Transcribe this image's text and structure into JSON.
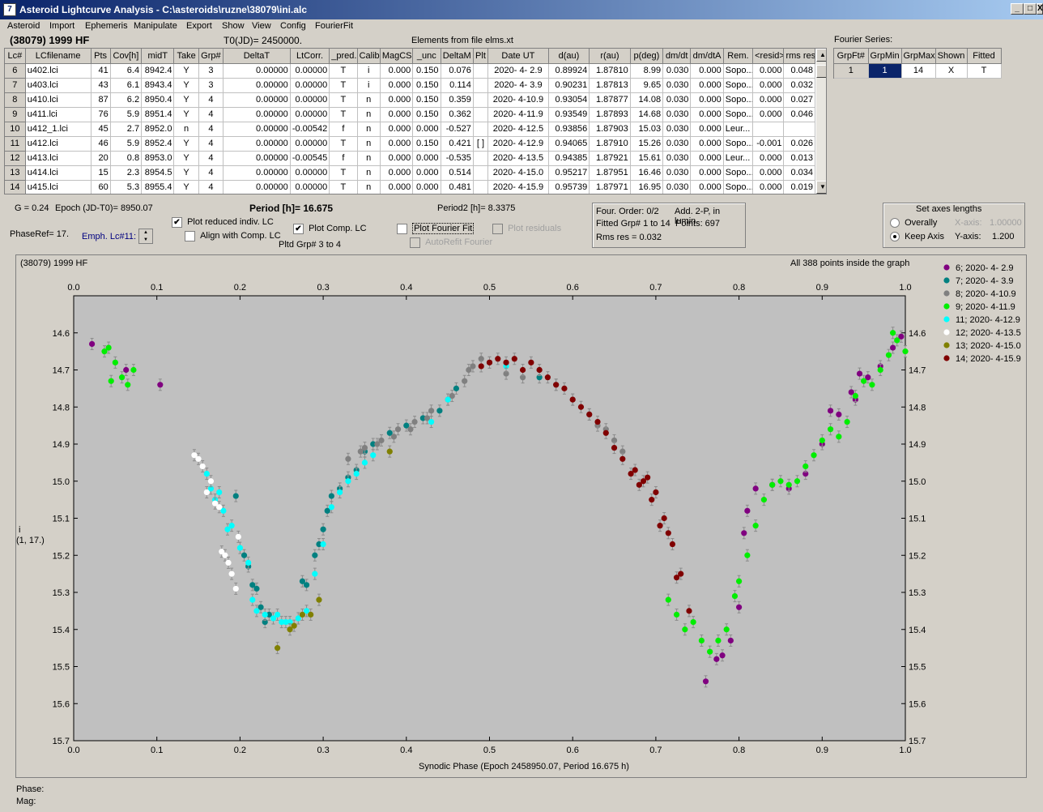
{
  "window": {
    "title": "Asteroid Lightcurve Analysis - C:\\asteroids\\ruzne\\38079\\ini.alc",
    "icon": "app-icon"
  },
  "menu": [
    "Asteroid",
    "Import",
    "Ephemeris",
    "Manipulate",
    "Export",
    "Show",
    "View",
    "Config",
    "FourierFit"
  ],
  "info": {
    "asteroid_name": "(38079) 1999 HF",
    "t0": "T0(JD)= 2450000.",
    "elements": "Elements from file elms.xt",
    "fourier_label": "Fourier Series:"
  },
  "lc_table": {
    "headers": [
      "Lc#",
      "LCfilename",
      "Pts",
      "Cov[h]",
      "midT",
      "Take",
      "Grp#",
      "DeltaT",
      "LtCorr.",
      "_pred.",
      "Calib.",
      "MagCS",
      "_unc",
      "DeltaM",
      "Plt",
      "Date UT",
      "d(au)",
      "r(au)",
      "p(deg)",
      "dm/dt",
      "dm/dtA",
      "Rem.",
      "<resid>",
      "rms res"
    ],
    "rows": [
      [
        "6",
        "u402.lci",
        "41",
        "6.4",
        "8942.4",
        "Y",
        "3",
        "0.00000",
        "0.00000",
        "T",
        "i",
        "0.000",
        "0.150",
        "0.076",
        "",
        "2020- 4- 2.9",
        "0.89924",
        "1.87810",
        "8.99",
        "0.030",
        "0.000",
        "Sopo...",
        "0.000",
        "0.048"
      ],
      [
        "7",
        "u403.lci",
        "43",
        "6.1",
        "8943.4",
        "Y",
        "3",
        "0.00000",
        "0.00000",
        "T",
        "i",
        "0.000",
        "0.150",
        "0.114",
        "",
        "2020- 4- 3.9",
        "0.90231",
        "1.87813",
        "9.65",
        "0.030",
        "0.000",
        "Sopo...",
        "0.000",
        "0.032"
      ],
      [
        "8",
        "u410.lci",
        "87",
        "6.2",
        "8950.4",
        "Y",
        "4",
        "0.00000",
        "0.00000",
        "T",
        "n",
        "0.000",
        "0.150",
        "0.359",
        "",
        "2020- 4-10.9",
        "0.93054",
        "1.87877",
        "14.08",
        "0.030",
        "0.000",
        "Sopo...",
        "0.000",
        "0.027"
      ],
      [
        "9",
        "u411.lci",
        "76",
        "5.9",
        "8951.4",
        "Y",
        "4",
        "0.00000",
        "0.00000",
        "T",
        "n",
        "0.000",
        "0.150",
        "0.362",
        "",
        "2020- 4-11.9",
        "0.93549",
        "1.87893",
        "14.68",
        "0.030",
        "0.000",
        "Sopo...",
        "0.000",
        "0.046"
      ],
      [
        "10",
        "u412_1.lci",
        "45",
        "2.7",
        "8952.0",
        "n",
        "4",
        "0.00000",
        "-0.00542",
        "f",
        "n",
        "0.000",
        "0.000",
        "-0.527",
        "",
        "2020- 4-12.5",
        "0.93856",
        "1.87903",
        "15.03",
        "0.030",
        "0.000",
        "Leur...",
        "",
        ""
      ],
      [
        "11",
        "u412.lci",
        "46",
        "5.9",
        "8952.4",
        "Y",
        "4",
        "0.00000",
        "0.00000",
        "T",
        "n",
        "0.000",
        "0.150",
        "0.421",
        "[ ]",
        "2020- 4-12.9",
        "0.94065",
        "1.87910",
        "15.26",
        "0.030",
        "0.000",
        "Sopo...",
        "-0.001",
        "0.026"
      ],
      [
        "12",
        "u413.lci",
        "20",
        "0.8",
        "8953.0",
        "Y",
        "4",
        "0.00000",
        "-0.00545",
        "f",
        "n",
        "0.000",
        "0.000",
        "-0.535",
        "",
        "2020- 4-13.5",
        "0.94385",
        "1.87921",
        "15.61",
        "0.030",
        "0.000",
        "Leur...",
        "0.000",
        "0.013"
      ],
      [
        "13",
        "u414.lci",
        "15",
        "2.3",
        "8954.5",
        "Y",
        "4",
        "0.00000",
        "0.00000",
        "T",
        "n",
        "0.000",
        "0.000",
        "0.514",
        "",
        "2020- 4-15.0",
        "0.95217",
        "1.87951",
        "16.46",
        "0.030",
        "0.000",
        "Sopo...",
        "0.000",
        "0.034"
      ],
      [
        "14",
        "u415.lci",
        "60",
        "5.3",
        "8955.4",
        "Y",
        "4",
        "0.00000",
        "0.00000",
        "T",
        "n",
        "0.000",
        "0.000",
        "0.481",
        "",
        "2020- 4-15.9",
        "0.95739",
        "1.87971",
        "16.95",
        "0.030",
        "0.000",
        "Sopo...",
        "0.000",
        "0.019"
      ]
    ]
  },
  "fourier_table": {
    "headers": [
      "GrpFt#",
      "GrpMin",
      "GrpMax",
      "Shown",
      "Fitted"
    ],
    "row": [
      "1",
      "1",
      "14",
      "X",
      "T"
    ]
  },
  "controls": {
    "g": "G = 0.24",
    "epoch": "Epoch (JD-T0)= 8950.07",
    "period": "Period [h]= 16.675",
    "period2": "Period2 [h]= 8.3375",
    "phaseref": "PhaseRef= 17.",
    "emph": "Emph. Lc#11:",
    "plot_reduced": "Plot reduced indiv. LC",
    "align_comp": "Align with Comp. LC",
    "plot_comp": "Plot Comp. LC",
    "pltd_grp": "Pltd Grp#  3   to   4",
    "plot_fourier": "Plot Fourier Fit",
    "autorefit": "AutoRefit Fourier",
    "plot_residuals": "Plot residuals",
    "check_mark": "✔"
  },
  "fourier_info": {
    "order": "Four. Order:  0/2",
    "add2p": "Add. 2-P, in lumin.",
    "fitted": "Fitted Grp# 1 to 14",
    "points": "Points: 697",
    "rms": "Rms res     = 0.032"
  },
  "axes_box": {
    "title": "Set axes lengths",
    "overally": "Overally",
    "keep_axis": "Keep Axis",
    "xaxis_label": "X-axis:",
    "xaxis_value": "1.00000",
    "yaxis_label": "Y-axis:",
    "yaxis_value": "1.200"
  },
  "plot": {
    "title_left": "(38079) 1999 HF",
    "title_right": "All 388 points inside the graph",
    "ylabel_top": "i",
    "ylabel_bottom": "(1, 17.)",
    "xlabel": "Synodic Phase (Epoch 2458950.07, Period 16.675 h)"
  },
  "chart_data": {
    "type": "scatter",
    "title": "(38079) 1999 HF",
    "xlabel": "Synodic Phase (Epoch 2458950.07, Period 16.675 h)",
    "ylabel": "i (1, 17.)",
    "xlim": [
      0.0,
      1.0
    ],
    "ylim": [
      15.7,
      14.5
    ],
    "y_inverted": true,
    "grid": false,
    "legend_position": "right-outside",
    "xticks": [
      0.0,
      0.1,
      0.2,
      0.3,
      0.4,
      0.5,
      0.6,
      0.7,
      0.8,
      0.9,
      1.0
    ],
    "yticks": [
      14.6,
      14.7,
      14.8,
      14.9,
      15.0,
      15.1,
      15.2,
      15.3,
      15.4,
      15.5,
      15.6,
      15.7
    ],
    "series": [
      {
        "name": "6; 2020- 4- 2.9",
        "color": "#800080",
        "points": [
          [
            0.022,
            14.63
          ],
          [
            0.063,
            14.7
          ],
          [
            0.104,
            14.74
          ],
          [
            0.78,
            15.47
          ],
          [
            0.79,
            15.43
          ],
          [
            0.8,
            15.34
          ],
          [
            0.806,
            15.14
          ],
          [
            0.81,
            15.08
          ],
          [
            0.82,
            15.02
          ],
          [
            0.84,
            15.01
          ],
          [
            0.86,
            15.02
          ],
          [
            0.88,
            14.98
          ],
          [
            0.9,
            14.9
          ],
          [
            0.92,
            14.82
          ],
          [
            0.94,
            14.78
          ],
          [
            0.955,
            14.72
          ],
          [
            0.97,
            14.69
          ],
          [
            0.985,
            14.64
          ],
          [
            0.995,
            14.61
          ],
          [
            0.76,
            15.54
          ],
          [
            0.773,
            15.48
          ],
          [
            0.91,
            14.81
          ],
          [
            0.935,
            14.76
          ],
          [
            0.945,
            14.71
          ]
        ]
      },
      {
        "name": "7; 2020- 4- 3.9",
        "color": "#008080",
        "points": [
          [
            0.21,
            15.23
          ],
          [
            0.215,
            15.28
          ],
          [
            0.22,
            15.29
          ],
          [
            0.225,
            15.34
          ],
          [
            0.23,
            15.38
          ],
          [
            0.235,
            15.36
          ],
          [
            0.275,
            15.27
          ],
          [
            0.28,
            15.28
          ],
          [
            0.29,
            15.2
          ],
          [
            0.295,
            15.17
          ],
          [
            0.3,
            15.13
          ],
          [
            0.305,
            15.08
          ],
          [
            0.31,
            15.04
          ],
          [
            0.32,
            15.02
          ],
          [
            0.33,
            14.99
          ],
          [
            0.34,
            14.97
          ],
          [
            0.35,
            14.92
          ],
          [
            0.36,
            14.9
          ],
          [
            0.38,
            14.87
          ],
          [
            0.4,
            14.85
          ],
          [
            0.42,
            14.83
          ],
          [
            0.44,
            14.81
          ],
          [
            0.46,
            14.75
          ],
          [
            0.56,
            14.72
          ],
          [
            0.195,
            15.04
          ],
          [
            0.205,
            15.2
          ]
        ]
      },
      {
        "name": "8; 2020- 4-10.9",
        "color": "#808080",
        "points": [
          [
            0.33,
            14.94
          ],
          [
            0.35,
            14.91
          ],
          [
            0.37,
            14.89
          ],
          [
            0.39,
            14.86
          ],
          [
            0.41,
            14.84
          ],
          [
            0.43,
            14.81
          ],
          [
            0.45,
            14.78
          ],
          [
            0.47,
            14.73
          ],
          [
            0.48,
            14.69
          ],
          [
            0.49,
            14.67
          ],
          [
            0.5,
            14.68
          ],
          [
            0.52,
            14.71
          ],
          [
            0.54,
            14.72
          ],
          [
            0.56,
            14.7
          ],
          [
            0.58,
            14.74
          ],
          [
            0.6,
            14.78
          ],
          [
            0.62,
            14.82
          ],
          [
            0.63,
            14.85
          ],
          [
            0.64,
            14.86
          ],
          [
            0.65,
            14.89
          ],
          [
            0.66,
            14.92
          ],
          [
            0.455,
            14.77
          ],
          [
            0.475,
            14.7
          ],
          [
            0.405,
            14.86
          ],
          [
            0.425,
            14.83
          ],
          [
            0.345,
            14.92
          ],
          [
            0.365,
            14.9
          ],
          [
            0.385,
            14.88
          ]
        ]
      },
      {
        "name": "9; 2020- 4-11.9",
        "color": "#00ee00",
        "points": [
          [
            0.037,
            14.65
          ],
          [
            0.045,
            14.73
          ],
          [
            0.05,
            14.68
          ],
          [
            0.058,
            14.72
          ],
          [
            0.065,
            14.74
          ],
          [
            0.072,
            14.7
          ],
          [
            0.042,
            14.64
          ],
          [
            0.715,
            15.32
          ],
          [
            0.725,
            15.36
          ],
          [
            0.735,
            15.4
          ],
          [
            0.745,
            15.38
          ],
          [
            0.755,
            15.43
          ],
          [
            0.765,
            15.46
          ],
          [
            0.775,
            15.43
          ],
          [
            0.785,
            15.4
          ],
          [
            0.795,
            15.31
          ],
          [
            0.8,
            15.27
          ],
          [
            0.81,
            15.2
          ],
          [
            0.82,
            15.12
          ],
          [
            0.83,
            15.05
          ],
          [
            0.84,
            15.01
          ],
          [
            0.85,
            15.0
          ],
          [
            0.86,
            15.01
          ],
          [
            0.87,
            15.0
          ],
          [
            0.88,
            14.96
          ],
          [
            0.89,
            14.93
          ],
          [
            0.9,
            14.89
          ],
          [
            0.91,
            14.86
          ],
          [
            0.92,
            14.88
          ],
          [
            0.93,
            14.84
          ],
          [
            0.94,
            14.77
          ],
          [
            0.95,
            14.73
          ],
          [
            0.96,
            14.74
          ],
          [
            0.97,
            14.7
          ],
          [
            0.98,
            14.66
          ],
          [
            0.99,
            14.62
          ],
          [
            1.0,
            14.65
          ],
          [
            0.985,
            14.6
          ]
        ]
      },
      {
        "name": "11; 2020- 4-12.9",
        "color": "#00ffff",
        "points": [
          [
            0.16,
            14.98
          ],
          [
            0.165,
            15.02
          ],
          [
            0.17,
            15.05
          ],
          [
            0.175,
            15.03
          ],
          [
            0.18,
            15.08
          ],
          [
            0.185,
            15.13
          ],
          [
            0.19,
            15.12
          ],
          [
            0.2,
            15.18
          ],
          [
            0.21,
            15.22
          ],
          [
            0.215,
            15.32
          ],
          [
            0.22,
            15.35
          ],
          [
            0.23,
            15.36
          ],
          [
            0.24,
            15.37
          ],
          [
            0.25,
            15.38
          ],
          [
            0.26,
            15.38
          ],
          [
            0.27,
            15.37
          ],
          [
            0.28,
            15.35
          ],
          [
            0.29,
            15.25
          ],
          [
            0.3,
            15.17
          ],
          [
            0.31,
            15.07
          ],
          [
            0.32,
            15.03
          ],
          [
            0.33,
            15.0
          ],
          [
            0.34,
            14.98
          ],
          [
            0.35,
            14.95
          ],
          [
            0.36,
            14.93
          ],
          [
            0.43,
            14.84
          ],
          [
            0.45,
            14.78
          ],
          [
            0.52,
            14.69
          ],
          [
            0.245,
            15.36
          ],
          [
            0.255,
            15.38
          ]
        ]
      },
      {
        "name": "12; 2020- 4-13.5",
        "color": "#ffffff",
        "points": [
          [
            0.145,
            14.93
          ],
          [
            0.15,
            14.94
          ],
          [
            0.155,
            14.96
          ],
          [
            0.16,
            15.03
          ],
          [
            0.165,
            15.0
          ],
          [
            0.17,
            15.06
          ],
          [
            0.175,
            15.07
          ],
          [
            0.178,
            15.19
          ],
          [
            0.182,
            15.2
          ],
          [
            0.186,
            15.22
          ],
          [
            0.19,
            15.25
          ],
          [
            0.195,
            15.29
          ],
          [
            0.198,
            15.15
          ]
        ]
      },
      {
        "name": "13; 2020- 4-15.0",
        "color": "#808000",
        "points": [
          [
            0.245,
            15.45
          ],
          [
            0.26,
            15.4
          ],
          [
            0.275,
            15.36
          ],
          [
            0.285,
            15.36
          ],
          [
            0.295,
            15.32
          ],
          [
            0.38,
            14.92
          ],
          [
            0.265,
            15.39
          ]
        ]
      },
      {
        "name": "14; 2020- 4-15.9",
        "color": "#800000",
        "points": [
          [
            0.49,
            14.69
          ],
          [
            0.5,
            14.68
          ],
          [
            0.51,
            14.67
          ],
          [
            0.52,
            14.68
          ],
          [
            0.53,
            14.67
          ],
          [
            0.54,
            14.7
          ],
          [
            0.55,
            14.68
          ],
          [
            0.56,
            14.7
          ],
          [
            0.57,
            14.72
          ],
          [
            0.58,
            14.74
          ],
          [
            0.59,
            14.75
          ],
          [
            0.6,
            14.78
          ],
          [
            0.61,
            14.8
          ],
          [
            0.62,
            14.82
          ],
          [
            0.63,
            14.84
          ],
          [
            0.64,
            14.87
          ],
          [
            0.65,
            14.91
          ],
          [
            0.66,
            14.94
          ],
          [
            0.67,
            14.98
          ],
          [
            0.68,
            15.01
          ],
          [
            0.69,
            14.99
          ],
          [
            0.7,
            15.03
          ],
          [
            0.71,
            15.1
          ],
          [
            0.72,
            15.17
          ],
          [
            0.73,
            15.25
          ],
          [
            0.74,
            15.35
          ],
          [
            0.675,
            14.97
          ],
          [
            0.685,
            15.0
          ],
          [
            0.695,
            15.05
          ],
          [
            0.705,
            15.12
          ],
          [
            0.715,
            15.14
          ],
          [
            0.725,
            15.26
          ]
        ]
      }
    ]
  }
}
